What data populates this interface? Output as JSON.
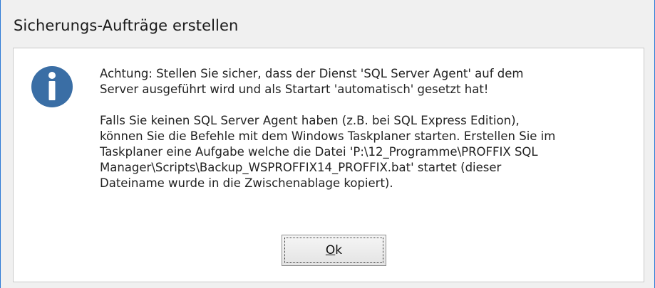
{
  "dialog": {
    "title": "Sicherungs-Aufträge erstellen",
    "icon": "info-icon",
    "message": {
      "paragraph_1": "Achtung: Stellen Sie sicher, dass der Dienst 'SQL Server Agent' auf dem\nServer ausgeführt wird und als Startart 'automatisch' gesetzt hat!",
      "paragraph_2": "Falls Sie keinen SQL Server Agent haben (z.B. bei SQL Express Edition),\nkönnen Sie die Befehle mit dem Windows Taskplaner starten. Erstellen Sie im\nTaskplaner eine Aufgabe welche die Datei 'P:\\12_Programme\\PROFFIX SQL\nManager\\Scripts\\Backup_WSPROFFIX14_PROFFIX.bat' startet (dieser\nDateiname wurde in die Zwischenablage kopiert)."
    },
    "ok_button": {
      "mnemonic": "O",
      "rest": "k"
    }
  },
  "colors": {
    "icon_blue": "#3a6ea5",
    "window_border": "#2b79d6",
    "background": "#f0f0f0"
  }
}
